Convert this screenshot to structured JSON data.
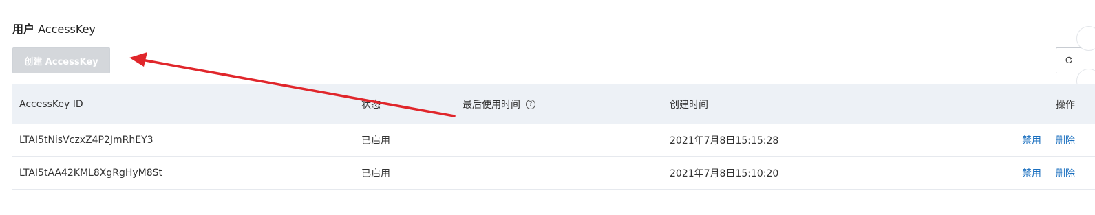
{
  "page": {
    "title_cn": "用户",
    "title_en": "AccessKey"
  },
  "toolbar": {
    "create_label": "创建 AccessKey",
    "refresh_icon": "refresh-icon"
  },
  "table": {
    "columns": {
      "id": "AccessKey ID",
      "status": "状态",
      "last_used": "最后使用时间",
      "created": "创建时间",
      "ops": "操作"
    },
    "rows": [
      {
        "id": "LTAI5tNisVczxZ4P2JmRhEY3",
        "status": "已启用",
        "last_used": "",
        "created": "2021年7月8日15:15:28",
        "disable": "禁用",
        "delete": "删除"
      },
      {
        "id": "LTAI5tAA42KML8XgRgHyM8St",
        "status": "已启用",
        "last_used": "",
        "created": "2021年7月8日15:10:20",
        "disable": "禁用",
        "delete": "删除"
      }
    ]
  },
  "annotation": {
    "type": "arrow",
    "color": "#e0262b"
  },
  "colors": {
    "header_bg": "#edf1f6",
    "link": "#1a6fbf",
    "disabled_button": "#d4d7db"
  }
}
